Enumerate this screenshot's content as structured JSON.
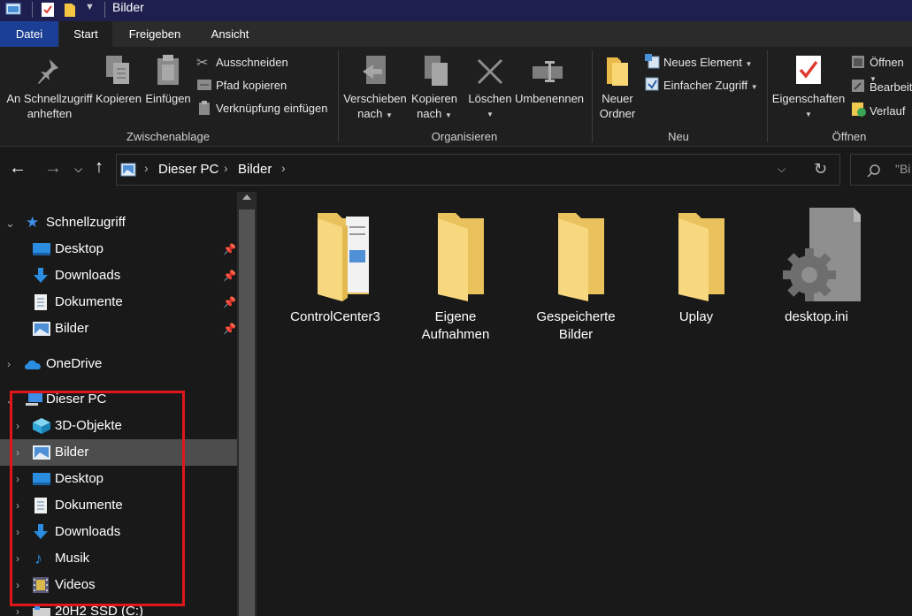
{
  "window": {
    "title": "Bilder"
  },
  "ribbon_tabs": [
    "Datei",
    "Start",
    "Freigeben",
    "Ansicht"
  ],
  "ribbon": {
    "clipboard": {
      "pin_quick_access_line1": "An Schnellzugriff",
      "pin_quick_access_line2": "anheften",
      "copy": "Kopieren",
      "paste": "Einfügen",
      "cut": "Ausschneiden",
      "copy_path": "Pfad kopieren",
      "paste_shortcut": "Verknüpfung einfügen",
      "group": "Zwischenablage"
    },
    "organize": {
      "move_line1": "Verschieben",
      "move_line2": "nach",
      "copy_to_line1": "Kopieren",
      "copy_to_line2": "nach",
      "delete": "Löschen",
      "rename": "Umbenennen",
      "group": "Organisieren"
    },
    "new": {
      "new_folder_line1": "Neuer",
      "new_folder_line2": "Ordner",
      "new_item": "Neues Element",
      "easy_access": "Einfacher Zugriff",
      "group": "Neu"
    },
    "open": {
      "properties": "Eigenschaften",
      "open": "Öffnen",
      "edit": "Bearbeiten",
      "history": "Verlauf",
      "group": "Öffnen"
    }
  },
  "address": {
    "crumbs": [
      "Dieser PC",
      "Bilder"
    ]
  },
  "search": {
    "placeholder": "\"Bi"
  },
  "sidebar": {
    "quick_access": {
      "label": "Schnellzugriff",
      "items": [
        "Desktop",
        "Downloads",
        "Dokumente",
        "Bilder"
      ]
    },
    "onedrive": "OneDrive",
    "this_pc": {
      "label": "Dieser PC",
      "items": [
        "3D-Objekte",
        "Bilder",
        "Desktop",
        "Dokumente",
        "Downloads",
        "Musik",
        "Videos"
      ],
      "drive": "20H2 SSD (C:)"
    },
    "selected": "Bilder"
  },
  "files": [
    {
      "name_line1": "ControlCenter3",
      "name_line2": "",
      "icon": "folder-with-documents-icon"
    },
    {
      "name_line1": "Eigene",
      "name_line2": "Aufnahmen",
      "icon": "folder-icon"
    },
    {
      "name_line1": "Gespeicherte",
      "name_line2": "Bilder",
      "icon": "folder-icon"
    },
    {
      "name_line1": "Uplay",
      "name_line2": "",
      "icon": "folder-icon"
    },
    {
      "name_line1": "desktop.ini",
      "name_line2": "",
      "icon": "settings-file-icon"
    }
  ],
  "colors": {
    "titlebar": "#1f1f4f",
    "file_tab": "#1b3f94",
    "background": "#191919",
    "highlight_box": "#e1161b",
    "folder": "#f5d77f"
  }
}
